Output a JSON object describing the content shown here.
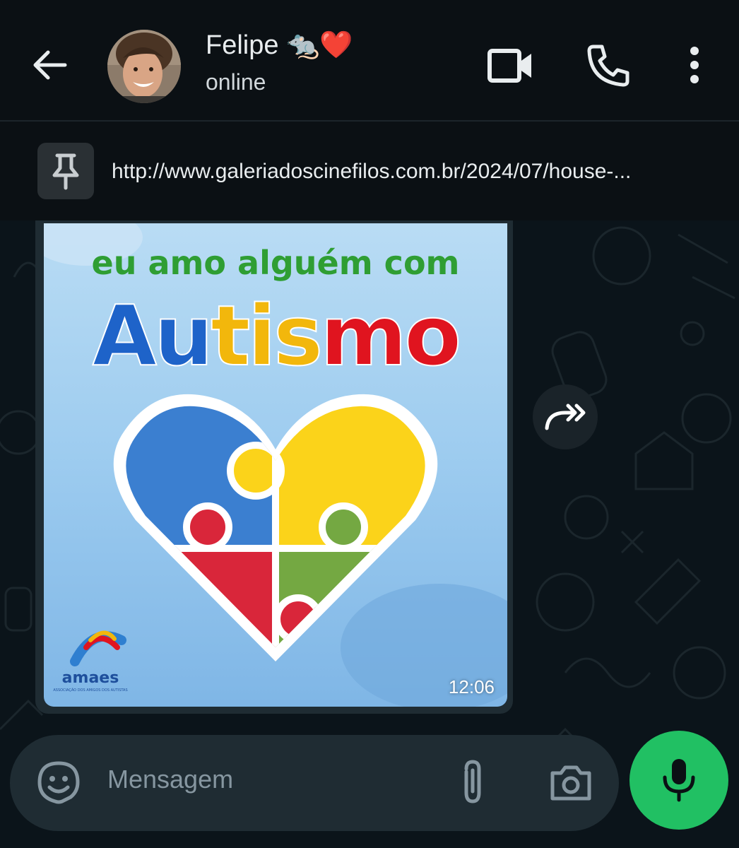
{
  "header": {
    "contact_name": "Felipe 🐀❤️",
    "status": "online",
    "back_icon": "arrow-left-icon",
    "video_icon": "video-camera-icon",
    "call_icon": "phone-icon",
    "menu_icon": "more-vertical-icon"
  },
  "pinned": {
    "icon": "pin-icon",
    "text": "http://www.galeriadoscinefilos.com.br/2024/07/house-..."
  },
  "message": {
    "image": {
      "headline": "eu amo alguém com",
      "word_parts": [
        {
          "text": "Au",
          "color": "#1e63c9"
        },
        {
          "text": "tis",
          "color": "#f2b70c"
        },
        {
          "text": "mo",
          "color": "#e0141f"
        }
      ],
      "logo_text": "amaes",
      "logo_subtext": "ASSOCIAÇÃO DOS AMIGOS DOS AUTISTAS",
      "puzzle_colors": [
        "#3b7fd0",
        "#fbd31a",
        "#d9263a",
        "#74a842"
      ]
    },
    "time": "12:06",
    "forward_icon": "forward-icon"
  },
  "composer": {
    "placeholder": "Mensagem",
    "sticker_icon": "sticker-icon",
    "attach_icon": "paperclip-icon",
    "camera_icon": "camera-icon",
    "mic_icon": "microphone-icon"
  },
  "colors": {
    "background": "#0b1014",
    "bubble": "#1f2c33",
    "accent": "#21c063"
  }
}
